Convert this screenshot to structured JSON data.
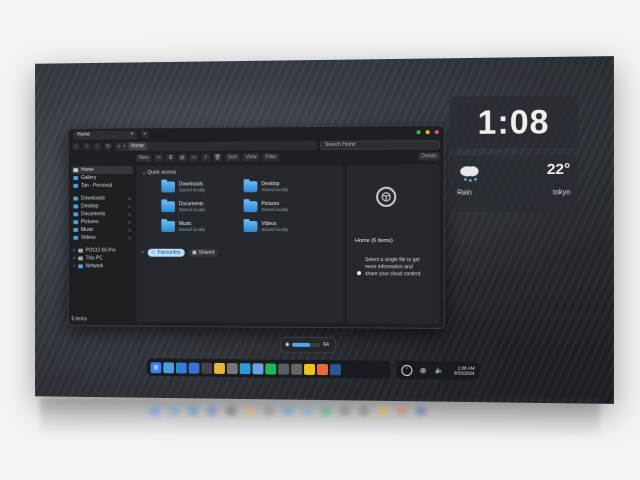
{
  "explorer": {
    "tab_title": "Home",
    "tab_close": "×",
    "tab_add": "+",
    "address": {
      "root_icon": "home-icon",
      "crumb": "Home"
    },
    "search_placeholder": "Search Home",
    "toolbar": {
      "new": "New",
      "sort": "Sort",
      "view": "View",
      "filter": "Filter",
      "details": "Details"
    },
    "sidebar": {
      "top": [
        {
          "label": "Home",
          "selected": true
        },
        {
          "label": "Gallery"
        },
        {
          "label": "Tan - Personal"
        }
      ],
      "pinned": [
        {
          "label": "Downloads"
        },
        {
          "label": "Desktop"
        },
        {
          "label": "Documents"
        },
        {
          "label": "Pictures"
        },
        {
          "label": "Music"
        },
        {
          "label": "Videos"
        }
      ],
      "devices": [
        {
          "label": "POCO X6 Pro"
        },
        {
          "label": "This PC"
        },
        {
          "label": "Network"
        }
      ],
      "footer": "6 items"
    },
    "quick_access": {
      "heading": "Quick access",
      "folders": [
        {
          "name": "Downloads",
          "sub": "Stored locally"
        },
        {
          "name": "Desktop",
          "sub": "Stored locally"
        },
        {
          "name": "Documents",
          "sub": "Stored locally"
        },
        {
          "name": "Pictures",
          "sub": "Stored locally"
        },
        {
          "name": "Music",
          "sub": "Stored locally"
        },
        {
          "name": "Videos",
          "sub": "Stored locally"
        }
      ]
    },
    "tags": {
      "favourites": "Favourites",
      "shared": "Shared"
    },
    "details_pane": {
      "title": "Home (6 items)",
      "message": "Select a single file to get more information and share your cloud content."
    }
  },
  "clock": {
    "hours": "1",
    "sep": ":",
    "minutes": "08"
  },
  "weather": {
    "temp": "22°",
    "condition": "Rain",
    "city": "tokyo",
    "icon": "rain-cloud-icon"
  },
  "volume": {
    "level": 64,
    "label": "64"
  },
  "taskbar": {
    "icons": [
      "start-icon",
      "file-explorer-icon",
      "edge-icon",
      "photos-icon",
      "terminal-icon",
      "chrome-icon",
      "settings-icon",
      "browser-icon",
      "notepad-icon",
      "spotify-icon",
      "media-icon",
      "store-icon",
      "sticky-notes-icon",
      "paint-icon",
      "app-icon"
    ],
    "colors": [
      "#3b82f6",
      "#4a9fe0",
      "#2f7fd1",
      "#3c6fd8",
      "#444",
      "#e8b73a",
      "#777",
      "#2a9bd8",
      "#6aa2e0",
      "#1db954",
      "#5a5f66",
      "#666",
      "#f0c419",
      "#e86b3a",
      "#2b5797"
    ]
  },
  "tray": {
    "time": "1:08 AM",
    "date": "8/15/2024"
  }
}
